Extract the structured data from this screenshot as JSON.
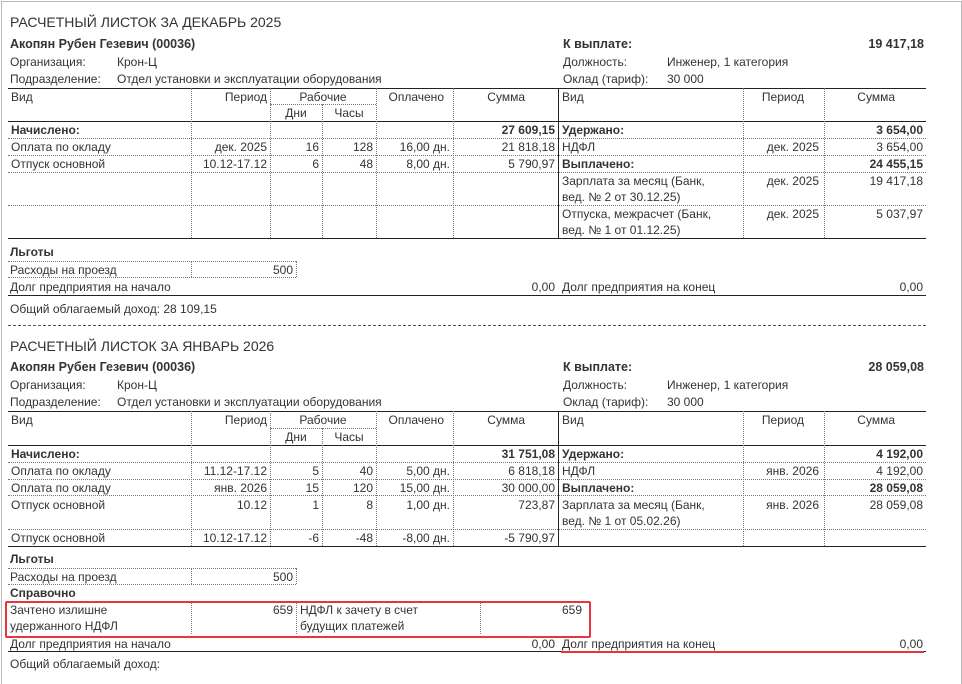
{
  "slip1": {
    "title": "РАСЧЕТНЫЙ ЛИСТОК ЗА ДЕКАБРЬ 2025",
    "employee": "Акопян Рубен Гезевич (00036)",
    "to_pay_label": "К выплате:",
    "to_pay": "19 417,18",
    "org_label": "Организация:",
    "org": "Крон-Ц",
    "dept_label": "Подразделение:",
    "dept": "Отдел установки и эксплуатации оборудования",
    "position_label": "Должность:",
    "position": "Инженер, 1 категория",
    "salary_label": "Оклад (тариф):",
    "salary": "30 000",
    "headers": {
      "vid": "Вид",
      "period": "Период",
      "work": "Рабочие",
      "days": "Дни",
      "hours": "Часы",
      "paid": "Оплачено",
      "sum": "Сумма",
      "vid2": "Вид",
      "period2": "Период",
      "sum2": "Сумма"
    },
    "accrued_label": "Начислено:",
    "accrued_total": "27 609,15",
    "accrued": [
      {
        "vid": "Оплата по окладу",
        "period": "дек. 2025",
        "days": "16",
        "hours": "128",
        "paid": "16,00 дн.",
        "sum": "21 818,18"
      },
      {
        "vid": "Отпуск основной",
        "period": "10.12-17.12",
        "days": "6",
        "hours": "48",
        "paid": "8,00 дн.",
        "sum": "5 790,97"
      }
    ],
    "withheld_label": "Удержано:",
    "withheld_total": "3 654,00",
    "withheld": [
      {
        "vid": "НДФЛ",
        "period": "дек. 2025",
        "sum": "3 654,00"
      }
    ],
    "paid_label": "Выплачено:",
    "paid_total": "24 455,15",
    "payouts": [
      {
        "line1": "Зарплата за месяц (Банк,",
        "line2": "вед. № 2 от 30.12.25)",
        "period": "дек. 2025",
        "sum": "19 417,18"
      },
      {
        "line1": "Отпуска, межрасчет (Банк,",
        "line2": "вед. № 1 от 01.12.25)",
        "period": "дек. 2025",
        "sum": "5 037,97"
      }
    ],
    "benefits_label": "Льготы",
    "benefit_name": "Расходы на проезд",
    "benefit_value": "500",
    "debt_start_label": "Долг предприятия на начало",
    "debt_start": "0,00",
    "debt_end_label": "Долг предприятия на конец",
    "debt_end": "0,00",
    "taxable_label": "Общий облагаемый доход: 28 109,15"
  },
  "slip2": {
    "title": "РАСЧЕТНЫЙ ЛИСТОК ЗА ЯНВАРЬ 2026",
    "employee": "Акопян Рубен Гезевич (00036)",
    "to_pay_label": "К выплате:",
    "to_pay": "28 059,08",
    "org_label": "Организация:",
    "org": "Крон-Ц",
    "dept_label": "Подразделение:",
    "dept": "Отдел установки и эксплуатации оборудования",
    "position_label": "Должность:",
    "position": "Инженер, 1 категория",
    "salary_label": "Оклад (тариф):",
    "salary": "30 000",
    "headers": {
      "vid": "Вид",
      "period": "Период",
      "work": "Рабочие",
      "days": "Дни",
      "hours": "Часы",
      "paid": "Оплачено",
      "sum": "Сумма",
      "vid2": "Вид",
      "period2": "Период",
      "sum2": "Сумма"
    },
    "accrued_label": "Начислено:",
    "accrued_total": "31 751,08",
    "accrued": [
      {
        "vid": "Оплата по окладу",
        "period": "11.12-17.12",
        "days": "5",
        "hours": "40",
        "paid": "5,00 дн.",
        "sum": "6 818,18"
      },
      {
        "vid": "Оплата по окладу",
        "period": "янв. 2026",
        "days": "15",
        "hours": "120",
        "paid": "15,00 дн.",
        "sum": "30 000,00"
      },
      {
        "vid": "Отпуск основной",
        "period": "10.12",
        "days": "1",
        "hours": "8",
        "paid": "1,00 дн.",
        "sum": "723,87"
      },
      {
        "vid": "Отпуск основной",
        "period": "10.12-17.12",
        "days": "-6",
        "hours": "-48",
        "paid": "-8,00 дн.",
        "sum": "-5 790,97"
      }
    ],
    "withheld_label": "Удержано:",
    "withheld_total": "4 192,00",
    "withheld": [
      {
        "vid": "НДФЛ",
        "period": "янв. 2026",
        "sum": "4 192,00"
      }
    ],
    "paid_label": "Выплачено:",
    "paid_total": "28 059,08",
    "payouts": [
      {
        "line1": "Зарплата за месяц (Банк,",
        "line2": "вед. № 1 от 05.02.26)",
        "period": "янв. 2026",
        "sum": "28 059,08"
      }
    ],
    "benefits_label": "Льготы",
    "benefit_name": "Расходы на проезд",
    "benefit_value": "500",
    "reference_label": "Справочно",
    "ref_left_line1": "Зачтено излишне",
    "ref_left_line2": "удержанного НДФЛ",
    "ref_left_value": "659",
    "ref_right_line1": "НДФЛ к зачету в счет",
    "ref_right_line2": "будущих платежей",
    "ref_right_value": "659",
    "debt_start_label": "Долг предприятия на начало",
    "debt_start": "0,00",
    "debt_end_label": "Долг предприятия на конец",
    "debt_end": "0,00",
    "taxable_label": "Общий облагаемый доход:"
  },
  "highlight_color": "#e8343f"
}
